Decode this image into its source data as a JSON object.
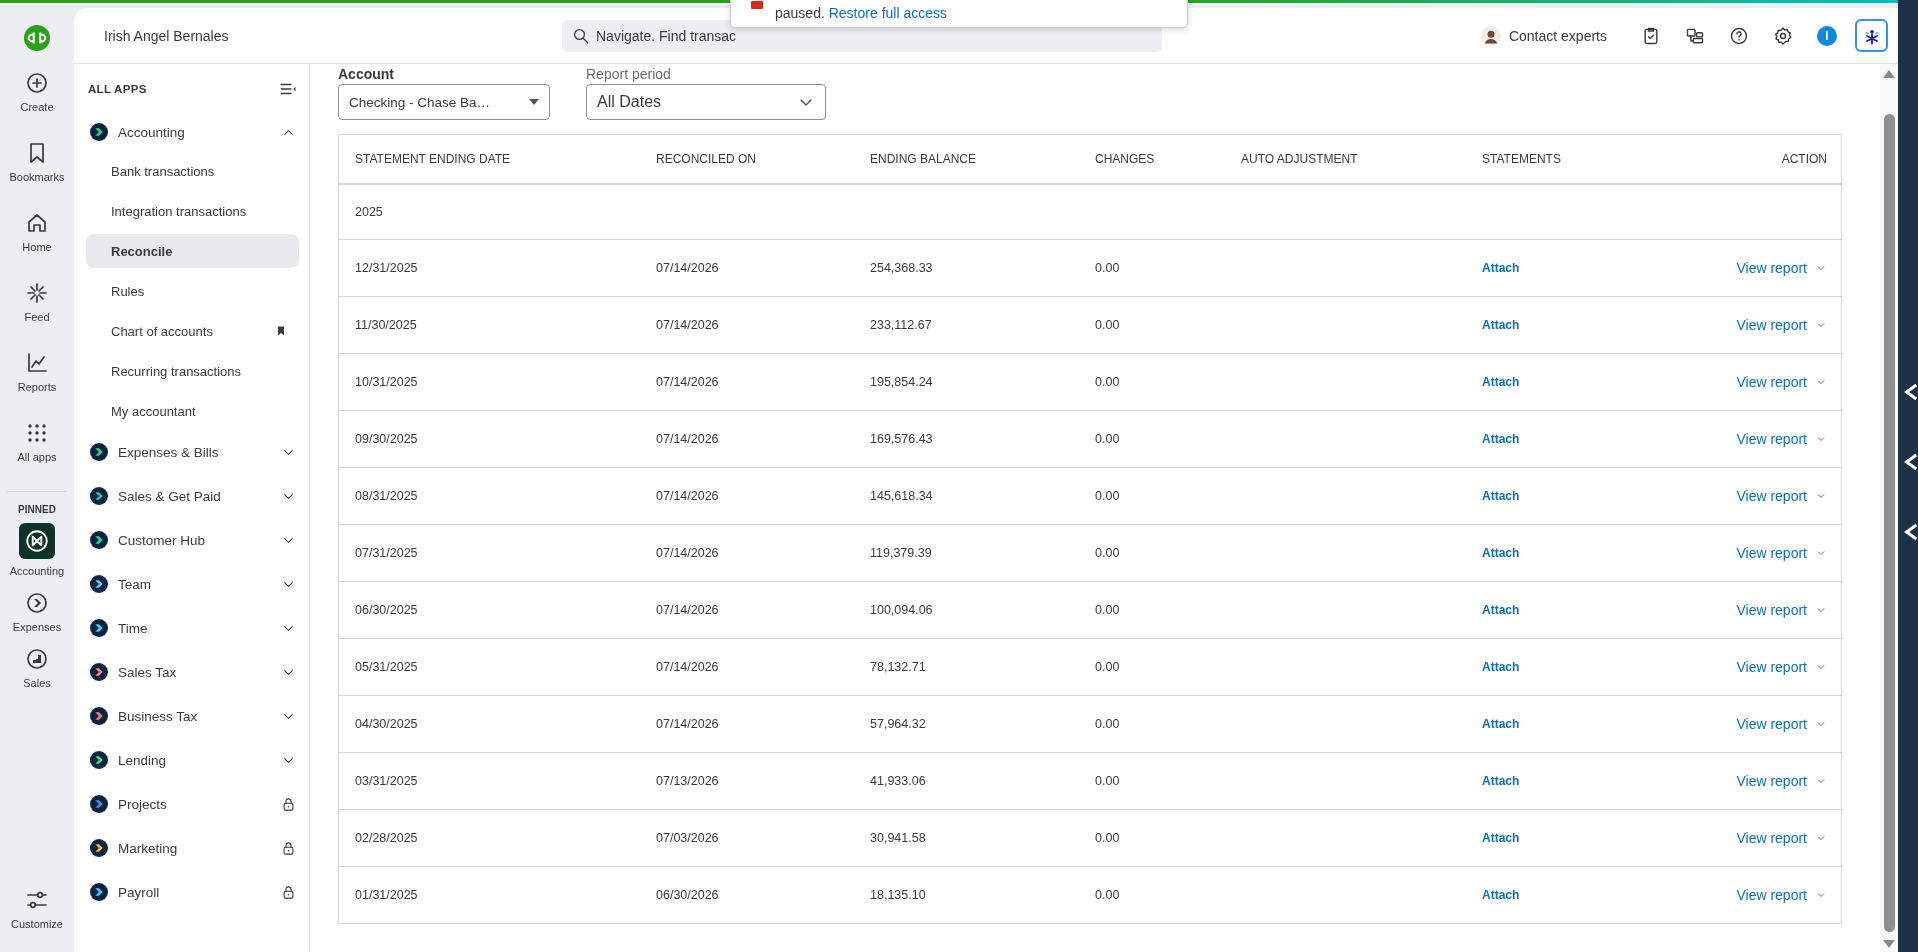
{
  "rail": {
    "items": [
      {
        "kind": "create",
        "label": "Create"
      },
      {
        "kind": "bookmarks",
        "label": "Bookmarks"
      },
      {
        "kind": "home",
        "label": "Home"
      },
      {
        "kind": "feed",
        "label": "Feed"
      },
      {
        "kind": "reports",
        "label": "Reports"
      },
      {
        "kind": "apps",
        "label": "All apps"
      }
    ],
    "pinned_heading": "PINNED",
    "pinned": [
      {
        "kind": "accounting",
        "label": "Accounting",
        "selected": true
      },
      {
        "kind": "expenses",
        "label": "Expenses",
        "selected": false
      },
      {
        "kind": "sales",
        "label": "Sales",
        "selected": false
      }
    ],
    "customize": "Customize"
  },
  "top_bar": {
    "company": "Irish Angel Bernales",
    "search": {
      "placeholder": "Navigate. Find transac"
    },
    "contact": "Contact experts",
    "profile_initial": "I"
  },
  "notification": {
    "text": "paused.",
    "link": "Restore full access"
  },
  "sidebar": {
    "heading": "ALL APPS",
    "apps": [
      {
        "label": "Accounting",
        "color": "#2ed47a",
        "expanded": true,
        "locked": false,
        "children": [
          {
            "label": "Bank transactions",
            "selected": false,
            "bookmarked": false
          },
          {
            "label": "Integration transactions",
            "selected": false,
            "bookmarked": false
          },
          {
            "label": "Reconcile",
            "selected": true,
            "bookmarked": false
          },
          {
            "label": "Rules",
            "selected": false,
            "bookmarked": false
          },
          {
            "label": "Chart of accounts",
            "selected": false,
            "bookmarked": true
          },
          {
            "label": "Recurring transactions",
            "selected": false,
            "bookmarked": false
          },
          {
            "label": "My accountant",
            "selected": false,
            "bookmarked": false
          }
        ]
      },
      {
        "label": "Expenses & Bills",
        "color": "#35d07f",
        "expanded": false,
        "locked": false
      },
      {
        "label": "Sales & Get Paid",
        "color": "#1fbfa0",
        "expanded": false,
        "locked": false
      },
      {
        "label": "Customer Hub",
        "color": "#2bd4a4",
        "expanded": false,
        "locked": false
      },
      {
        "label": "Team",
        "color": "#62c8f5",
        "expanded": false,
        "locked": false
      },
      {
        "label": "Time",
        "color": "#3fd0f2",
        "expanded": false,
        "locked": false
      },
      {
        "label": "Sales Tax",
        "color": "#ff8080",
        "expanded": false,
        "locked": false
      },
      {
        "label": "Business Tax",
        "color": "#f47c7c",
        "expanded": false,
        "locked": false
      },
      {
        "label": "Lending",
        "color": "#3ddc84",
        "expanded": false,
        "locked": false
      },
      {
        "label": "Projects",
        "color": "#4a90e2",
        "expanded": false,
        "locked": true
      },
      {
        "label": "Marketing",
        "color": "#f5b82e",
        "expanded": false,
        "locked": true
      },
      {
        "label": "Payroll",
        "color": "#3ec5f0",
        "expanded": false,
        "locked": true
      }
    ]
  },
  "filters": {
    "account": {
      "label": "Account",
      "value": "Checking - Chase Ba…"
    },
    "period": {
      "label": "Report period",
      "value": "All Dates"
    }
  },
  "table": {
    "columns": [
      "STATEMENT ENDING DATE",
      "RECONCILED ON",
      "ENDING BALANCE",
      "CHANGES",
      "AUTO ADJUSTMENT",
      "STATEMENTS",
      "ACTION"
    ],
    "groups": [
      {
        "label": "2025",
        "rows": [
          {
            "statement_date": "12/31/2025",
            "reconciled_on": "07/14/2026",
            "ending_balance": "254,368.33",
            "changes": "0.00",
            "statement": "Attach",
            "action": "View report"
          },
          {
            "statement_date": "11/30/2025",
            "reconciled_on": "07/14/2026",
            "ending_balance": "233,112.67",
            "changes": "0.00",
            "statement": "Attach",
            "action": "View report"
          },
          {
            "statement_date": "10/31/2025",
            "reconciled_on": "07/14/2026",
            "ending_balance": "195,854.24",
            "changes": "0.00",
            "statement": "Attach",
            "action": "View report"
          },
          {
            "statement_date": "09/30/2025",
            "reconciled_on": "07/14/2026",
            "ending_balance": "169,576.43",
            "changes": "0.00",
            "statement": "Attach",
            "action": "View report"
          },
          {
            "statement_date": "08/31/2025",
            "reconciled_on": "07/14/2026",
            "ending_balance": "145,618.34",
            "changes": "0.00",
            "statement": "Attach",
            "action": "View report"
          },
          {
            "statement_date": "07/31/2025",
            "reconciled_on": "07/14/2026",
            "ending_balance": "119,379.39",
            "changes": "0.00",
            "statement": "Attach",
            "action": "View report"
          },
          {
            "statement_date": "06/30/2025",
            "reconciled_on": "07/14/2026",
            "ending_balance": "100,094.06",
            "changes": "0.00",
            "statement": "Attach",
            "action": "View report"
          },
          {
            "statement_date": "05/31/2025",
            "reconciled_on": "07/14/2026",
            "ending_balance": "78,132.71",
            "changes": "0.00",
            "statement": "Attach",
            "action": "View report"
          },
          {
            "statement_date": "04/30/2025",
            "reconciled_on": "07/14/2026",
            "ending_balance": "57,964.32",
            "changes": "0.00",
            "statement": "Attach",
            "action": "View report"
          },
          {
            "statement_date": "03/31/2025",
            "reconciled_on": "07/13/2026",
            "ending_balance": "41,933.06",
            "changes": "0.00",
            "statement": "Attach",
            "action": "View report"
          },
          {
            "statement_date": "02/28/2025",
            "reconciled_on": "07/03/2026",
            "ending_balance": "30,941.58",
            "changes": "0.00",
            "statement": "Attach",
            "action": "View report"
          },
          {
            "statement_date": "01/31/2025",
            "reconciled_on": "06/30/2026",
            "ending_balance": "18,135.10",
            "changes": "0.00",
            "statement": "Attach",
            "action": "View report"
          }
        ]
      }
    ]
  }
}
